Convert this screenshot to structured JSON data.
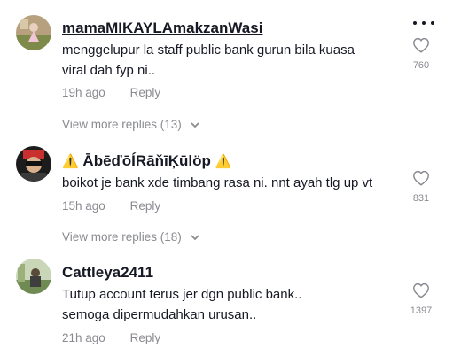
{
  "comments": [
    {
      "username": "mamaMIKAYLAmakzanWasi",
      "text_lines": [
        "menggelupur la staff public bank gurun bila kuasa",
        "viral dah fyp ni.."
      ],
      "time": "19h ago",
      "reply_label": "Reply",
      "likes": "760",
      "view_more": "View more replies (13)",
      "avatar_icon": "user-avatar-icon"
    },
    {
      "username": "ĀbēďōÍRāňīĶūlöp",
      "username_prefix": "⚠️",
      "username_suffix": "⚠️",
      "text_lines": [
        "boikot je bank xde timbang rasa ni. nnt ayah tlg up vt"
      ],
      "time": "15h ago",
      "reply_label": "Reply",
      "likes": "831",
      "view_more": "View more replies (18)",
      "avatar_icon": "user-avatar-icon"
    },
    {
      "username": "Cattleya2411",
      "text_lines": [
        "Tutup account terus jer dgn public bank..",
        "semoga dipermudahkan urusan.."
      ],
      "time": "21h ago",
      "reply_label": "Reply",
      "likes": "1397",
      "avatar_icon": "user-avatar-icon"
    }
  ],
  "icons": {
    "more": "more-options-icon",
    "like": "heart-outline-icon",
    "expand": "chevron-down-icon"
  },
  "colors": {
    "text": "#161823",
    "secondary": "#8a8b91"
  }
}
